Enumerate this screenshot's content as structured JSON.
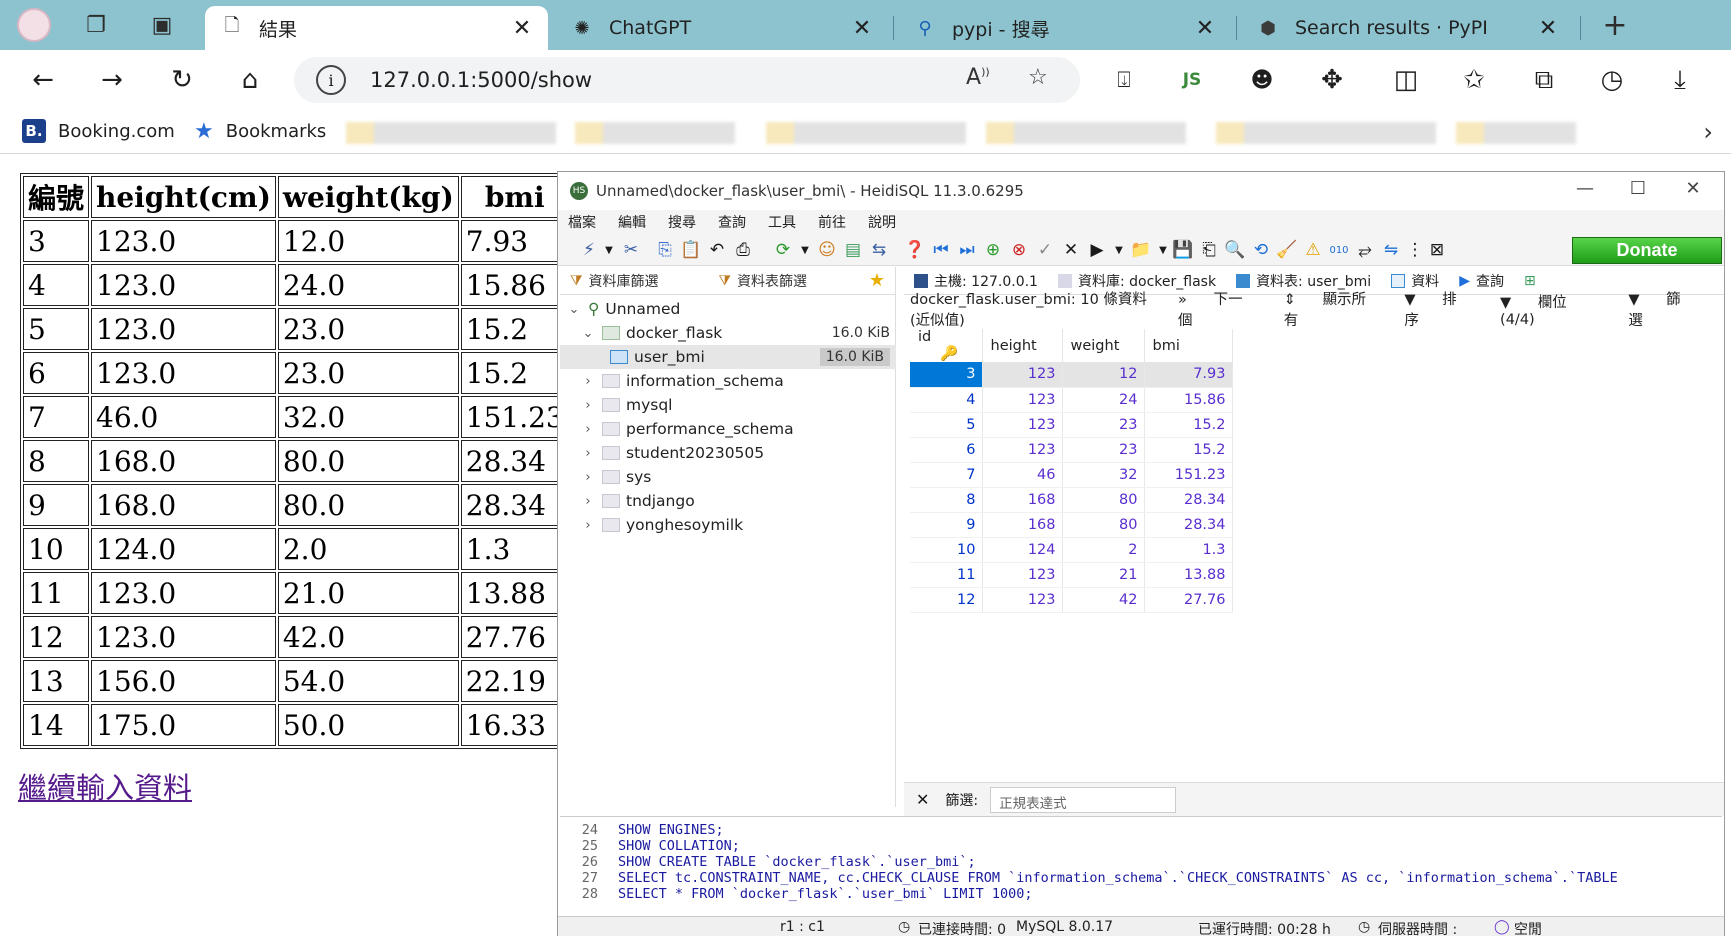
{
  "browser": {
    "tabs": [
      {
        "title": "結果",
        "active": true
      },
      {
        "title": "ChatGPT",
        "active": false
      },
      {
        "title": "pypi - 搜尋",
        "active": false
      },
      {
        "title": "Search results · PyPI",
        "active": false
      }
    ],
    "url": "127.0.0.1:5000/show",
    "bookmarks": [
      {
        "label": "Booking.com"
      },
      {
        "label": "Bookmarks"
      }
    ]
  },
  "page": {
    "table": {
      "headers": [
        "編號",
        "height(cm)",
        "weight(kg)",
        "bmi"
      ],
      "rows": [
        [
          "3",
          "123.0",
          "12.0",
          "7.93"
        ],
        [
          "4",
          "123.0",
          "24.0",
          "15.86"
        ],
        [
          "5",
          "123.0",
          "23.0",
          "15.2"
        ],
        [
          "6",
          "123.0",
          "23.0",
          "15.2"
        ],
        [
          "7",
          "46.0",
          "32.0",
          "151.23"
        ],
        [
          "8",
          "168.0",
          "80.0",
          "28.34"
        ],
        [
          "9",
          "168.0",
          "80.0",
          "28.34"
        ],
        [
          "10",
          "124.0",
          "2.0",
          "1.3"
        ],
        [
          "11",
          "123.0",
          "21.0",
          "13.88"
        ],
        [
          "12",
          "123.0",
          "42.0",
          "27.76"
        ],
        [
          "13",
          "156.0",
          "54.0",
          "22.19"
        ],
        [
          "14",
          "175.0",
          "50.0",
          "16.33"
        ]
      ]
    },
    "continue_link": "繼續輸入資料"
  },
  "heidi": {
    "title": "Unnamed\\docker_flask\\user_bmi\\ - HeidiSQL 11.3.0.6295",
    "menu": [
      "檔案",
      "編輯",
      "搜尋",
      "查詢",
      "工具",
      "前往",
      "說明"
    ],
    "donate": "Donate",
    "left_tabs": [
      "資料庫篩選",
      "資料表篩選"
    ],
    "tree": {
      "root": "Unnamed",
      "db": "docker_flask",
      "db_size": "16.0 KiB",
      "table": "user_bmi",
      "table_size": "16.0 KiB",
      "others": [
        "information_schema",
        "mysql",
        "performance_schema",
        "student20230505",
        "sys",
        "tndjango",
        "yonghesoymilk"
      ]
    },
    "right_tabs": [
      "主機: 127.0.0.1",
      "資料庫: docker_flask",
      "資料表: user_bmi",
      "資料",
      "查詢"
    ],
    "info": {
      "summary": "docker_flask.user_bmi: 10 條資料 (近似值)",
      "next": "下一個",
      "show_all": "顯示所有",
      "sort": "排序",
      "columns": "欄位 (4/4)",
      "filter": "篩選"
    },
    "grid": {
      "headers": [
        "id",
        "height",
        "weight",
        "bmi"
      ],
      "rows": [
        [
          "3",
          "123",
          "12",
          "7.93"
        ],
        [
          "4",
          "123",
          "24",
          "15.86"
        ],
        [
          "5",
          "123",
          "23",
          "15.2"
        ],
        [
          "6",
          "123",
          "23",
          "15.2"
        ],
        [
          "7",
          "46",
          "32",
          "151.23"
        ],
        [
          "8",
          "168",
          "80",
          "28.34"
        ],
        [
          "9",
          "168",
          "80",
          "28.34"
        ],
        [
          "10",
          "124",
          "2",
          "1.3"
        ],
        [
          "11",
          "123",
          "21",
          "13.88"
        ],
        [
          "12",
          "123",
          "42",
          "27.76"
        ]
      ]
    },
    "filter_bar": {
      "label": "篩選:",
      "placeholder": "正規表達式"
    },
    "sql": [
      {
        "no": "24",
        "text": "SHOW ENGINES;"
      },
      {
        "no": "25",
        "text": "SHOW COLLATION;"
      },
      {
        "no": "26",
        "text": "SHOW CREATE TABLE `docker_flask`.`user_bmi`;"
      },
      {
        "no": "27",
        "text": "SELECT tc.CONSTRAINT_NAME, cc.CHECK_CLAUSE FROM `information_schema`.`CHECK_CONSTRAINTS` AS cc, `information_schema`.`TABLE"
      },
      {
        "no": "28",
        "text": "SELECT * FROM `docker_flask`.`user_bmi` LIMIT 1000;"
      }
    ],
    "status": {
      "cursor": "r1 : c1",
      "connected": "已連接時間: 0",
      "server": "MySQL 8.0.17",
      "uptime": "已運行時間: 00:28 h",
      "server_time": "伺服器時間 :",
      "idle": "空閒"
    }
  }
}
